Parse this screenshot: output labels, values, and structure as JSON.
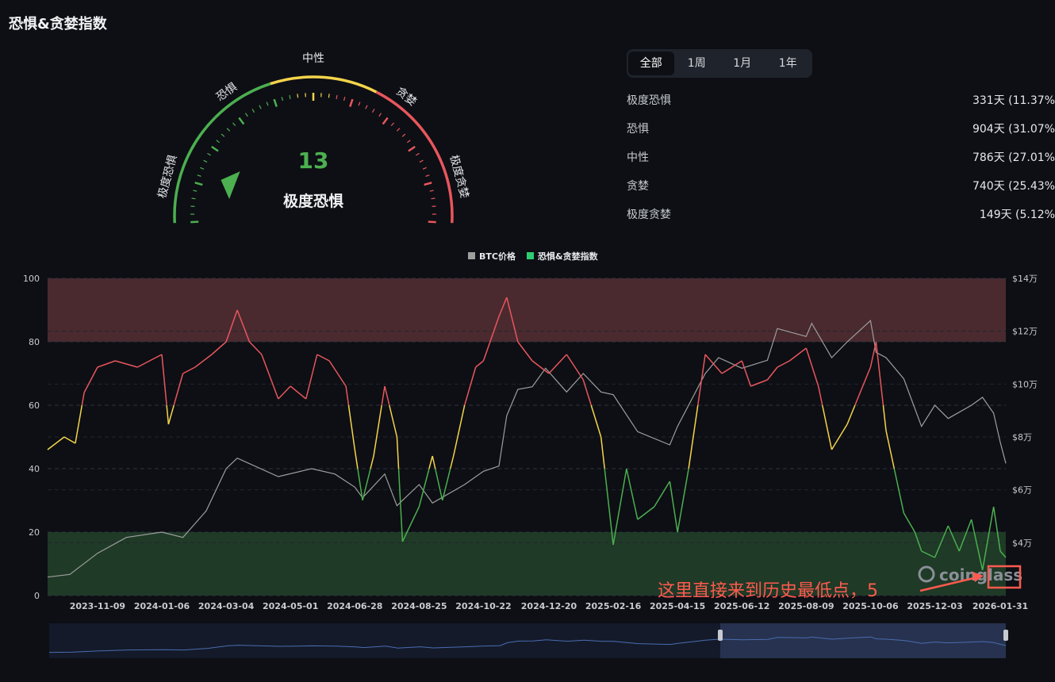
{
  "page": {
    "title": "恐惧&贪婪指数"
  },
  "gauge": {
    "value": "13",
    "label": "极度恐惧",
    "value_color": "#4caf50",
    "zone_labels": [
      "极度恐惧",
      "恐惧",
      "中性",
      "贪婪",
      "极度贪婪"
    ],
    "zone_colors": [
      "#4caf50",
      "#4caf50",
      "#f5d44b",
      "#e8565d",
      "#e8565d"
    ]
  },
  "tabs": [
    {
      "label": "全部",
      "active": true
    },
    {
      "label": "1周",
      "active": false
    },
    {
      "label": "1月",
      "active": false
    },
    {
      "label": "1年",
      "active": false
    }
  ],
  "stats": [
    {
      "label": "极度恐惧",
      "value": "331天 (11.37%"
    },
    {
      "label": "恐惧",
      "value": "904天 (31.07%"
    },
    {
      "label": "中性",
      "value": "786天 (27.01%"
    },
    {
      "label": "贪婪",
      "value": "740天 (25.43%"
    },
    {
      "label": "极度贪婪",
      "value": "149天 (5.12%"
    }
  ],
  "chart_data": {
    "type": "line",
    "legend": {
      "position": "top-center",
      "items": [
        {
          "name": "BTC价格",
          "color": "#9e9e9e"
        },
        {
          "name": "恐惧&贪婪指数",
          "color": "#2ecc71"
        }
      ]
    },
    "x_ticks": [
      "2023-11-09",
      "2024-01-06",
      "2024-03-04",
      "2024-05-01",
      "2024-06-28",
      "2024-08-25",
      "2024-10-22",
      "2024-12-20",
      "2025-02-16",
      "2025-04-15",
      "2025-06-12",
      "2025-08-09",
      "2025-10-06",
      "2025-12-03",
      "2026-01-31"
    ],
    "y_left": {
      "range": [
        0,
        100
      ],
      "ticks": [
        "0",
        "20",
        "40",
        "60",
        "80",
        "100"
      ]
    },
    "y_right": {
      "range": [
        20000,
        140000
      ],
      "ticks": [
        "$4万",
        "$6万",
        "$8万",
        "$10万",
        "$12万",
        "$14万"
      ]
    },
    "bands": [
      {
        "from": 80,
        "to": 100,
        "color": "#4a2a2f"
      },
      {
        "from": 0,
        "to": 20,
        "color": "#1f3a26"
      }
    ],
    "thresholds": {
      "greed": 60,
      "fear": 40,
      "colors": {
        "greed": "#e8565d",
        "neutral": "#f5d44b",
        "fear": "#4caf50"
      }
    },
    "series": [
      {
        "name": "恐惧&贪婪指数",
        "x": [
          "2023-09-25",
          "2023-10-10",
          "2023-10-20",
          "2023-10-28",
          "2023-11-09",
          "2023-11-25",
          "2023-12-15",
          "2024-01-06",
          "2024-01-12",
          "2024-01-25",
          "2024-02-05",
          "2024-02-20",
          "2024-03-04",
          "2024-03-14",
          "2024-03-25",
          "2024-04-05",
          "2024-04-20",
          "2024-05-01",
          "2024-05-15",
          "2024-05-25",
          "2024-06-05",
          "2024-06-20",
          "2024-06-28",
          "2024-07-05",
          "2024-07-15",
          "2024-07-25",
          "2024-08-05",
          "2024-08-10",
          "2024-08-25",
          "2024-09-06",
          "2024-09-15",
          "2024-09-25",
          "2024-10-05",
          "2024-10-15",
          "2024-10-22",
          "2024-11-05",
          "2024-11-12",
          "2024-11-22",
          "2024-12-05",
          "2024-12-20",
          "2025-01-05",
          "2025-01-20",
          "2025-02-05",
          "2025-02-16",
          "2025-02-28",
          "2025-03-10",
          "2025-03-25",
          "2025-04-08",
          "2025-04-15",
          "2025-04-25",
          "2025-05-10",
          "2025-05-25",
          "2025-06-12",
          "2025-06-20",
          "2025-07-05",
          "2025-07-14",
          "2025-07-25",
          "2025-08-09",
          "2025-08-20",
          "2025-09-01",
          "2025-09-15",
          "2025-10-06",
          "2025-10-11",
          "2025-10-20",
          "2025-11-05",
          "2025-11-15",
          "2025-11-21",
          "2025-12-03",
          "2025-12-15",
          "2025-12-25",
          "2026-01-05",
          "2026-01-15",
          "2026-01-25",
          "2026-01-31",
          "2026-02-05"
        ],
        "values": [
          46,
          50,
          48,
          64,
          72,
          74,
          72,
          76,
          54,
          70,
          72,
          76,
          80,
          90,
          80,
          76,
          62,
          66,
          62,
          76,
          74,
          66,
          46,
          30,
          44,
          66,
          50,
          17,
          28,
          44,
          30,
          44,
          60,
          72,
          74,
          88,
          94,
          80,
          74,
          70,
          76,
          68,
          50,
          16,
          40,
          24,
          28,
          36,
          20,
          40,
          76,
          70,
          74,
          66,
          68,
          72,
          74,
          78,
          66,
          46,
          54,
          72,
          80,
          52,
          26,
          20,
          14,
          12,
          22,
          14,
          24,
          8,
          28,
          14,
          12
        ]
      },
      {
        "name": "BTC价格",
        "x": [
          "2023-09-25",
          "2023-10-15",
          "2023-11-09",
          "2023-12-05",
          "2024-01-06",
          "2024-01-25",
          "2024-02-15",
          "2024-03-04",
          "2024-03-14",
          "2024-04-20",
          "2024-05-20",
          "2024-06-10",
          "2024-06-28",
          "2024-07-05",
          "2024-07-25",
          "2024-08-05",
          "2024-08-25",
          "2024-09-06",
          "2024-10-05",
          "2024-10-22",
          "2024-11-05",
          "2024-11-12",
          "2024-11-22",
          "2024-12-05",
          "2024-12-17",
          "2025-01-05",
          "2025-01-20",
          "2025-02-05",
          "2025-02-16",
          "2025-03-10",
          "2025-04-08",
          "2025-04-15",
          "2025-05-10",
          "2025-05-22",
          "2025-06-12",
          "2025-07-05",
          "2025-07-14",
          "2025-08-09",
          "2025-08-14",
          "2025-09-01",
          "2025-09-15",
          "2025-10-06",
          "2025-10-11",
          "2025-10-20",
          "2025-11-05",
          "2025-11-21",
          "2025-12-03",
          "2025-12-15",
          "2026-01-05",
          "2026-01-15",
          "2026-01-25",
          "2026-01-31",
          "2026-02-05"
        ],
        "values": [
          27000,
          28000,
          36000,
          42000,
          44000,
          42000,
          52000,
          68000,
          72000,
          65000,
          68000,
          66000,
          61000,
          57000,
          66000,
          54000,
          62000,
          55000,
          62000,
          67000,
          69000,
          88000,
          98000,
          99000,
          106000,
          97000,
          104000,
          97000,
          96000,
          82000,
          77000,
          84000,
          104000,
          110000,
          106000,
          109000,
          121000,
          118000,
          123000,
          110000,
          116000,
          124000,
          112000,
          110000,
          102000,
          84000,
          92000,
          87000,
          92000,
          95000,
          89000,
          78000,
          70000
        ]
      }
    ]
  },
  "navigator": {
    "handle_icon": "drag-handle-icon"
  },
  "watermark": {
    "text": "coinglass"
  },
  "annotation": {
    "text": "这里直接来到历史最低点，5"
  }
}
